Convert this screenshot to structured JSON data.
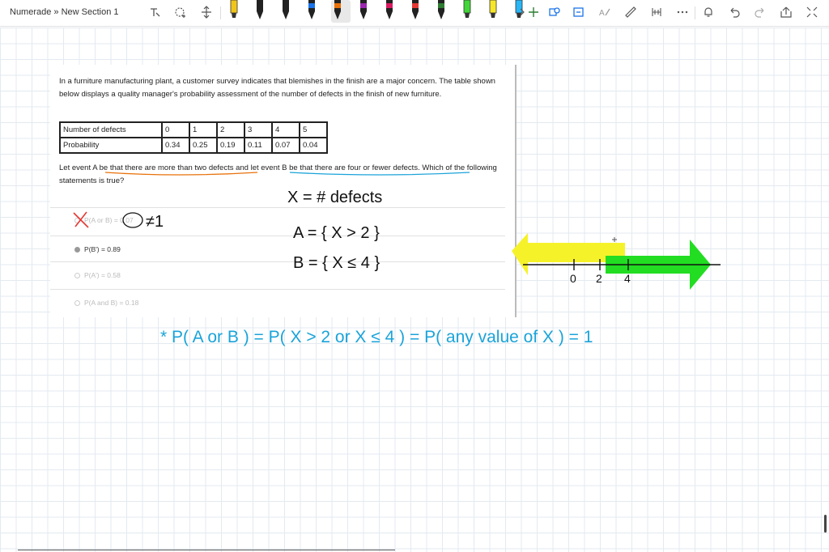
{
  "breadcrumb": "Numerade » New Section 1",
  "toolbar": {
    "left_tools": [
      "lasso-select-icon",
      "add-space-icon",
      "move-icon"
    ],
    "pens": [
      {
        "color": "#f0c419",
        "kind": "highlighter"
      },
      {
        "color": "#222222",
        "kind": "pen"
      },
      {
        "color": "#222222",
        "kind": "pen"
      },
      {
        "color": "#1a73e8",
        "kind": "pen"
      },
      {
        "color": "#e8710a",
        "kind": "pen",
        "selected": true
      },
      {
        "color": "#9c27b0",
        "kind": "pen"
      },
      {
        "color": "#d81b60",
        "kind": "pen"
      },
      {
        "color": "#e53935",
        "kind": "pen"
      },
      {
        "color": "#2e7d32",
        "kind": "pen"
      },
      {
        "color": "#43d63a",
        "kind": "highlighter"
      },
      {
        "color": "#f6e62a",
        "kind": "highlighter"
      },
      {
        "color": "#29b6f6",
        "kind": "highlighter"
      }
    ],
    "right_tools": [
      "add-pen-icon",
      "shapes-icon",
      "ink-to-shape-icon",
      "ink-to-text-icon",
      "ruler-icon",
      "protractor-icon",
      "more-icon",
      "notifications-icon",
      "undo-icon",
      "redo-icon",
      "share-icon",
      "fullscreen-icon"
    ]
  },
  "question": {
    "intro": "In a furniture manufacturing plant, a customer survey indicates that blemishes in the finish are a major concern. The table shown below displays a quality manager's probability assessment of the number of defects in the finish of new furniture.",
    "table": {
      "row1_label": "Number of defects",
      "row1": [
        "0",
        "1",
        "2",
        "3",
        "4",
        "5"
      ],
      "row2_label": "Probability",
      "row2": [
        "0.34",
        "0.25",
        "0.19",
        "0.11",
        "0.07",
        "0.04"
      ]
    },
    "prompt": "Let event A be that there are more than two defects and let event B be that there are four or fewer defects. Which of the following statements is true?",
    "options": [
      {
        "label": "P(A or B) = 0.07",
        "state": "crossed"
      },
      {
        "label": "P(B') = 0.89",
        "state": "active"
      },
      {
        "label": "P(A') = 0.58",
        "state": "faded"
      },
      {
        "label": "P(A and B) = 0.18",
        "state": "faded"
      }
    ]
  },
  "ink": {
    "color_black": "#111111",
    "color_blue": "#1aa3d9",
    "color_yellow": "#f6f22a",
    "color_green": "#22dd22",
    "color_orange": "#e8710a",
    "color_red": "#e53935",
    "correction": "≠1",
    "line_x": "X = # defects",
    "line_a": "A = { X > 2 }",
    "line_b": "B = { X ≤ 4 }",
    "tick_0": "0",
    "tick_2": "2",
    "tick_4": "4",
    "conclusion": "* P( A or B ) = P( X > 2 or X ≤ 4 ) = P( any value of X ) = 1"
  }
}
